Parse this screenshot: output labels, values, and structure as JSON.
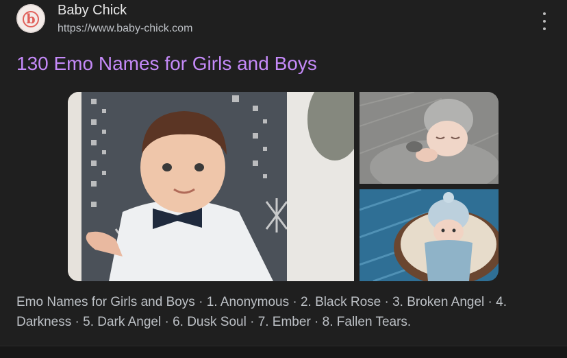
{
  "result": {
    "site_name": "Baby Chick",
    "site_url": "https://www.baby-chick.com",
    "favicon_letter": "b",
    "favicon_color": "#e0605a",
    "title": "130 Emo Names for Girls and Boys",
    "snippet": "Emo Names for Girls and Boys · 1. Anonymous · 2. Black Rose · 3. Broken Angel · 4. Darkness · 5. Dark Angel · 6. Dusk Soul · 7. Ember · 8. Fallen Tears."
  },
  "colors": {
    "background": "#1f1f1f",
    "title_link": "#c58af9",
    "primary_text": "#e8e8e8",
    "secondary_text": "#bdc1c6"
  },
  "icons": {
    "menu": "more-vert-icon"
  }
}
